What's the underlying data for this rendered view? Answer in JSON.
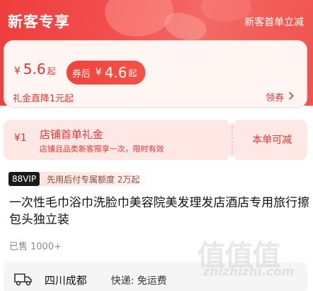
{
  "banner": {
    "title": "新客专享",
    "subtitle": "新客首单立减"
  },
  "price": {
    "currency": "¥",
    "current": "5.6",
    "current_suffix": "起",
    "after_label": "券后",
    "after_value": "4.6",
    "after_suffix": "起",
    "drop_text": "礼金直降1元起",
    "claim_label": "领券"
  },
  "coupon": {
    "amount": "¥1",
    "title": "店铺首单礼金",
    "desc": "店铺且品类新客限享一次，限时有效",
    "use_label": "本单可减"
  },
  "vip": {
    "badge": "88VIP",
    "text": "先用后付专属额度 2万起"
  },
  "product": {
    "title": "一次性毛巾浴巾洗脸巾美容院美发理发店酒店专用旅行擦包头独立装",
    "sold": "已售 1000+"
  },
  "shipping": {
    "location": "四川成都",
    "fee": "快递: 免运费"
  },
  "watermark": {
    "glyphs": "值值值",
    "url": "zhizhizhi.com"
  },
  "colors": {
    "accent": "#e8322f",
    "banner": "#f04a48"
  }
}
